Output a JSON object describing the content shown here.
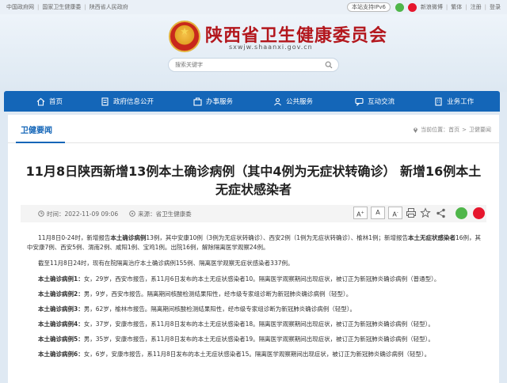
{
  "topbar": {
    "links_left": [
      "中国政府网",
      "国家卫生健康委",
      "陕西省人民政府"
    ],
    "ipv6": "本站支持IPv6",
    "links_right": [
      "新浪微博",
      "繁体",
      "注册",
      "登录"
    ]
  },
  "header": {
    "title": "陕西省卫生健康委员会",
    "domain": "sxwjw.shaanxi.gov.cn",
    "search_placeholder": "搜索关键字"
  },
  "nav": [
    {
      "label": "首页",
      "icon": "home-icon"
    },
    {
      "label": "政府信息公开",
      "icon": "document-icon"
    },
    {
      "label": "办事服务",
      "icon": "briefcase-icon"
    },
    {
      "label": "公共服务",
      "icon": "people-icon"
    },
    {
      "label": "互动交流",
      "icon": "chat-icon"
    },
    {
      "label": "业务工作",
      "icon": "building-icon"
    }
  ],
  "section": {
    "title": "卫健要闻",
    "breadcrumb_prefix": "当前位置：",
    "breadcrumb": [
      "首页",
      "卫健要闻"
    ]
  },
  "article": {
    "title": "11月8日陕西新增13例本土确诊病例（其中4例为无症状转确诊） 新增16例本土无症状感染者",
    "time_label": "时间：",
    "time": "2022-11-09 09:06",
    "source_label": "来源：",
    "source": "省卫生健康委",
    "font_buttons": [
      "A+",
      "A",
      "A-"
    ],
    "share_label": "分享"
  },
  "body": {
    "p1_a": "11月8日0-24时，新增报告",
    "p1_b": "本土确诊病例",
    "p1_c": "13例，其中安康10例（3例为无症状转确诊）、西安2例（1例为无症状转确诊）、榆林1例；新增报告",
    "p1_d": "本土无症状感染者",
    "p1_e": "16例，其中安康7例、西安5例、渭南2例、咸阳1例、宝鸡1例。出院16例，解除隔离医学观察24例。",
    "p2": "截至11月8日24时，现有在院隔离治疗本土确诊病例155例、隔离医学观察无症状感染者337例。",
    "cases": [
      {
        "label": "本土确诊病例1：",
        "text": "女，29岁，西安市报告，系11月6日发布的本土无症状感染者10。隔离医学观察期间出现症状，被订正为新冠肺炎确诊病例（普通型）。"
      },
      {
        "label": "本土确诊病例2：",
        "text": "男，9岁，西安市报告。隔离期间核酸检测结果阳性，经市级专家组诊断为新冠肺炎确诊病例（轻型）。"
      },
      {
        "label": "本土确诊病例3：",
        "text": "男，62岁，榆林市报告。隔离期间核酸检测结果阳性，经市级专家组诊断为新冠肺炎确诊病例（轻型）。"
      },
      {
        "label": "本土确诊病例4：",
        "text": "女，37岁，安康市报告，系11月8日发布的本土无症状感染者18。隔离医学观察期间出现症状，被订正为新冠肺炎确诊病例（轻型）。"
      },
      {
        "label": "本土确诊病例5：",
        "text": "男，35岁，安康市报告，系11月8日发布的本土无症状感染者19。隔离医学观察期间出现症状，被订正为新冠肺炎确诊病例（轻型）。"
      },
      {
        "label": "本土确诊病例6：",
        "text": "女，6岁，安康市报告，系11月8日发布的本土无症状感染者15。隔离医学观察期间出现症状，被订正为新冠肺炎确诊病例（轻型）。"
      }
    ]
  }
}
